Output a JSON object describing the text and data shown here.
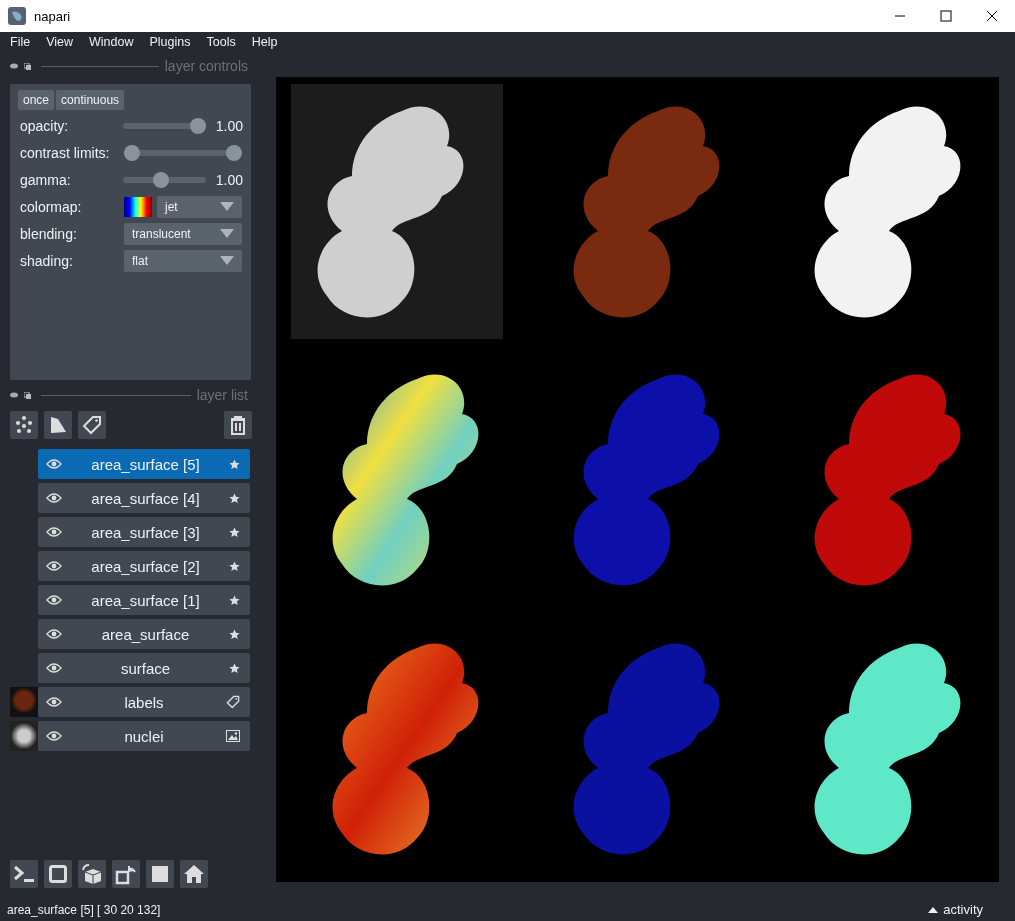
{
  "window": {
    "title": "napari"
  },
  "menu": [
    "File",
    "View",
    "Window",
    "Plugins",
    "Tools",
    "Help"
  ],
  "layer_controls": {
    "title": "layer controls",
    "buttons": [
      "once",
      "continuous"
    ],
    "opacity": {
      "label": "opacity:",
      "level": 1.0,
      "reading": "1.00"
    },
    "contrast_limits": {
      "label": "contrast limits:",
      "thumbs": [
        {
          "level": 0.0
        },
        {
          "level": 1.0
        }
      ]
    },
    "gamma": {
      "label": "gamma:",
      "level": 0.45,
      "reading": "1.00"
    },
    "colormap": {
      "label": "colormap:",
      "value": "jet"
    },
    "blending": {
      "label": "blending:",
      "value": "translucent"
    },
    "shading": {
      "label": "shading:",
      "value": "flat"
    }
  },
  "layer_list": {
    "title": "layer list",
    "layers": [
      {
        "name": "area_surface [5]",
        "kind": "surface",
        "selected": true,
        "visible": true
      },
      {
        "name": "area_surface [4]",
        "kind": "surface",
        "selected": false,
        "visible": true
      },
      {
        "name": "area_surface [3]",
        "kind": "surface",
        "selected": false,
        "visible": true
      },
      {
        "name": "area_surface [2]",
        "kind": "surface",
        "selected": false,
        "visible": true
      },
      {
        "name": "area_surface [1]",
        "kind": "surface",
        "selected": false,
        "visible": true
      },
      {
        "name": "area_surface",
        "kind": "surface",
        "selected": false,
        "visible": true
      },
      {
        "name": "surface",
        "kind": "surface",
        "selected": false,
        "visible": true
      },
      {
        "name": "labels",
        "kind": "labels",
        "selected": false,
        "visible": true
      },
      {
        "name": "nuclei",
        "kind": "image",
        "selected": false,
        "visible": true
      }
    ]
  },
  "status_bar": {
    "text": "area_surface [5] [ 30  20 132]",
    "activity": "activity"
  }
}
